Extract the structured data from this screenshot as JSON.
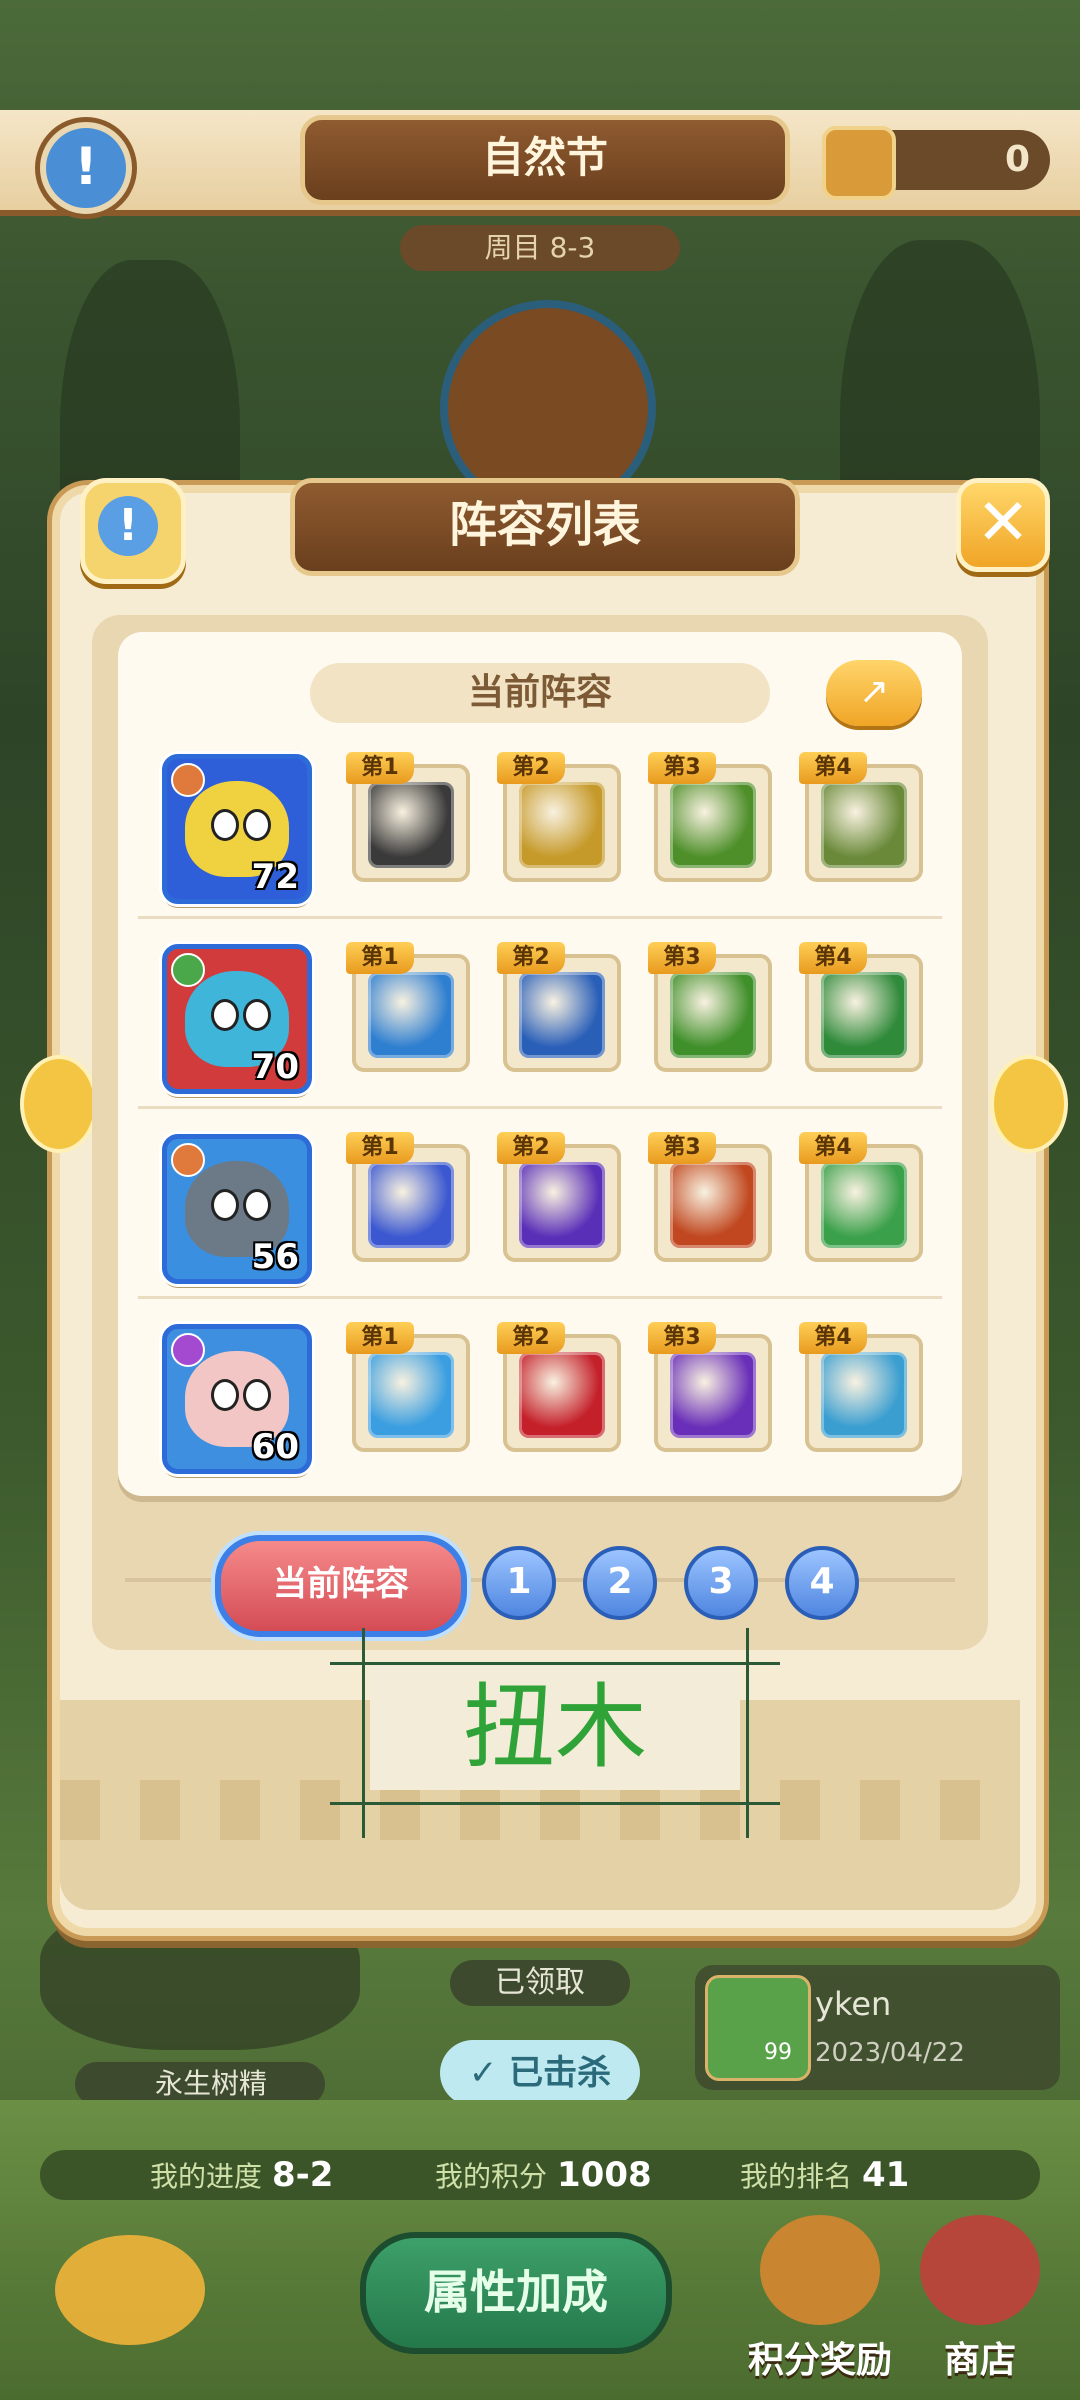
{
  "header": {
    "title": "自然节",
    "round": "周目 8-3",
    "currency": "0"
  },
  "dialog": {
    "title": "阵容列表",
    "current_label": "当前阵容",
    "close_icon": "close-icon"
  },
  "lineup": [
    {
      "level": "72",
      "hero_color": "#f0d240",
      "bg": "#2f5fd8",
      "elem": "#e07a3c",
      "skills": [
        {
          "tag": "第1",
          "color": "#3a3a3a"
        },
        {
          "tag": "第2",
          "color": "#c69a2a"
        },
        {
          "tag": "第3",
          "color": "#4e8f2a"
        },
        {
          "tag": "第4",
          "color": "#6a8a3a"
        }
      ]
    },
    {
      "level": "70",
      "hero_color": "#3fb6d9",
      "bg": "#d23b3b",
      "elem": "#4aa84a",
      "skills": [
        {
          "tag": "第1",
          "color": "#2f7fd0"
        },
        {
          "tag": "第2",
          "color": "#2a5fb8"
        },
        {
          "tag": "第3",
          "color": "#3f8f2a"
        },
        {
          "tag": "第4",
          "color": "#2f8a3a"
        }
      ]
    },
    {
      "level": "56",
      "hero_color": "#6b7a86",
      "bg": "#3b8fe0",
      "elem": "#e07a3c",
      "skills": [
        {
          "tag": "第1",
          "color": "#3b58d0"
        },
        {
          "tag": "第2",
          "color": "#5a2fb8"
        },
        {
          "tag": "第3",
          "color": "#c0471f"
        },
        {
          "tag": "第4",
          "color": "#3aa04a"
        }
      ]
    },
    {
      "level": "60",
      "hero_color": "#f3c6c6",
      "bg": "#3f8fe0",
      "elem": "#a34ad0",
      "skills": [
        {
          "tag": "第1",
          "color": "#3a9ee0"
        },
        {
          "tag": "第2",
          "color": "#c4202a"
        },
        {
          "tag": "第3",
          "color": "#6a2fb8"
        },
        {
          "tag": "第4",
          "color": "#3a9ed0"
        }
      ]
    }
  ],
  "tabs": {
    "main": "当前阵容",
    "nums": [
      "1",
      "2",
      "3",
      "4"
    ]
  },
  "stamp": "扭木",
  "background": {
    "claimed": "已领取",
    "defeated": "已击杀",
    "boss_name": "永生树精",
    "player": {
      "name": "yken",
      "date": "2023/04/22",
      "level": "99"
    }
  },
  "stats": {
    "progress_label": "我的进度",
    "progress": "8-2",
    "score_label": "我的积分",
    "score": "1008",
    "rank_label": "我的排名",
    "rank": "41"
  },
  "bottom": {
    "bonus": "属性加成",
    "rewards": "积分奖励",
    "shop": "商店"
  }
}
